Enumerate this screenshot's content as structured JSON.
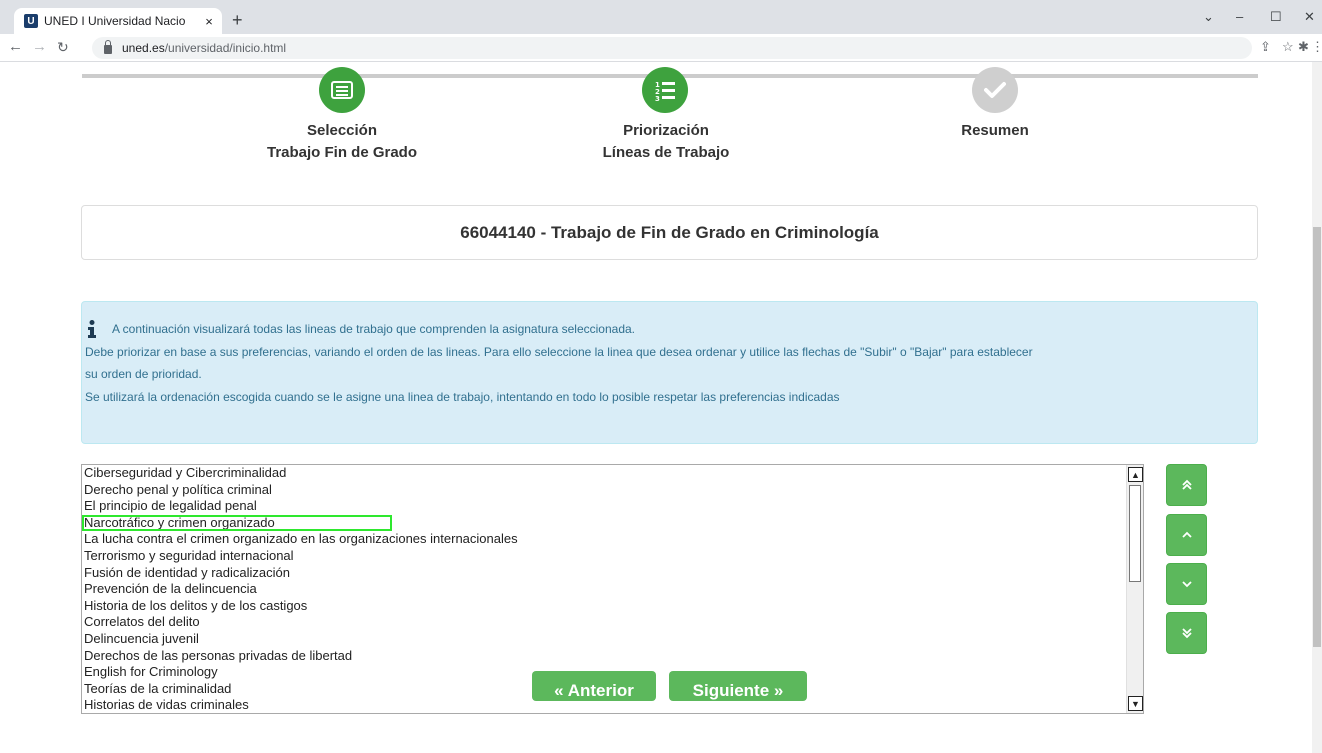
{
  "browser": {
    "tab_title": "UNED I Universidad Nacio",
    "tab_close": "×",
    "favicon_letter": "U",
    "new_tab": "+",
    "url_host": "uned.es",
    "url_path": "/universidad/inicio.html",
    "window_controls": [
      "⌄",
      "–",
      "☐",
      "✕"
    ]
  },
  "stepper": {
    "steps": [
      {
        "line1": "Selección",
        "line2": "Trabajo Fin de Grado",
        "state": "active",
        "icon": "list-card-icon"
      },
      {
        "line1": "Priorización",
        "line2": "Líneas de Trabajo",
        "state": "active",
        "icon": "numbered-list-icon"
      },
      {
        "line1": "Resumen",
        "line2": "",
        "state": "pending",
        "icon": "check-icon"
      }
    ]
  },
  "subject": {
    "title": "66044140 - Trabajo de Fin de Grado en Criminología"
  },
  "info": {
    "line1": "A continuación visualizará todas las lineas de trabajo que comprenden la asignatura seleccionada.",
    "line2": "Debe priorizar en base a sus preferencias, variando el orden de las lineas. Para ello seleccione la linea que desea ordenar y utilice las flechas de \"Subir\" o \"Bajar\" para establecer",
    "line3": "su orden de prioridad.",
    "line4": "Se utilizará la ordenación escogida cuando se le asigne una linea de trabajo, intentando en todo lo posible respetar las preferencias indicadas"
  },
  "lines_list": {
    "selected_index": 3,
    "items": [
      "Ciberseguridad y Cibercriminalidad",
      "Derecho penal y política criminal",
      "El principio de legalidad penal",
      "Narcotráfico y crimen organizado",
      "La lucha contra el crimen organizado en las organizaciones internacionales",
      "Terrorismo y seguridad internacional",
      "Fusión de identidad y radicalización",
      "Prevención de la delincuencia",
      "Historia de los delitos y de los castigos",
      "Correlatos del delito",
      "Delincuencia juvenil",
      "Derechos de las personas privadas de libertad",
      "English for Criminology",
      "Teorías de la criminalidad",
      "Historias de vidas criminales"
    ]
  },
  "order_buttons": {
    "top": "double-chevron-up-icon",
    "up": "chevron-up-icon",
    "down": "chevron-down-icon",
    "bottom": "double-chevron-down-icon"
  },
  "nav_buttons": {
    "previous": "« Anterior",
    "next": "Siguiente »"
  },
  "colors": {
    "green": "#3ea23e",
    "button_green": "#5cb85c",
    "info_bg": "#d9edf7",
    "info_text": "#31708f"
  }
}
